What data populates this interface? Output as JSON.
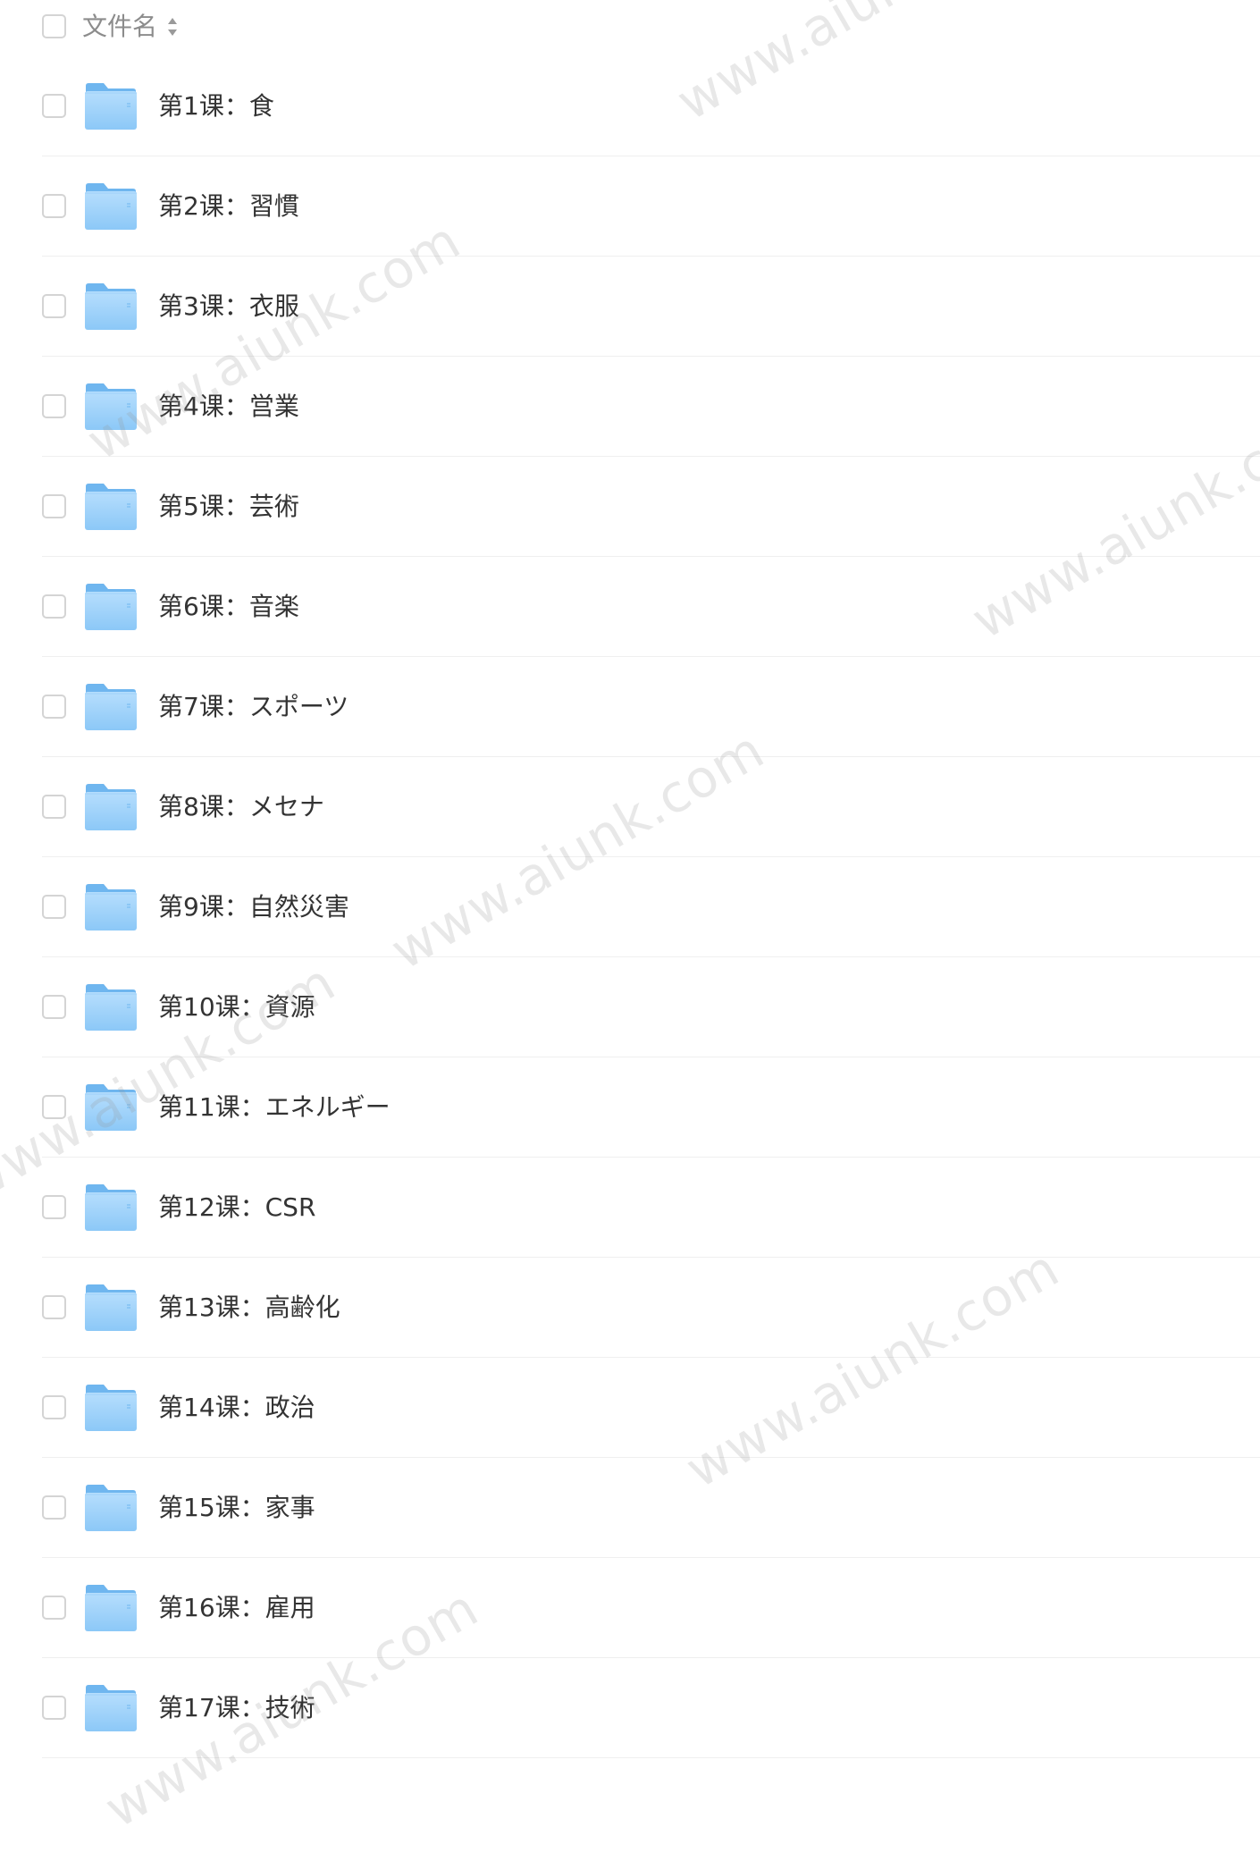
{
  "header": {
    "column_label": "文件名",
    "sort_icon": "sort-updown-icon"
  },
  "files": [
    {
      "name": "第1课：食",
      "icon": "folder-icon"
    },
    {
      "name": "第2课：習慣",
      "icon": "folder-icon"
    },
    {
      "name": "第3课：衣服",
      "icon": "folder-icon"
    },
    {
      "name": "第4课：営業",
      "icon": "folder-icon"
    },
    {
      "name": "第5课：芸術",
      "icon": "folder-icon"
    },
    {
      "name": "第6课：音楽",
      "icon": "folder-icon"
    },
    {
      "name": "第7课：スポーツ",
      "icon": "folder-icon"
    },
    {
      "name": "第8课：メセナ",
      "icon": "folder-icon"
    },
    {
      "name": "第9课：自然災害",
      "icon": "folder-icon"
    },
    {
      "name": "第10课：資源",
      "icon": "folder-icon"
    },
    {
      "name": "第11课：エネルギー",
      "icon": "folder-icon"
    },
    {
      "name": "第12课：CSR",
      "icon": "folder-icon"
    },
    {
      "name": "第13课：高齢化",
      "icon": "folder-icon"
    },
    {
      "name": "第14课：政治",
      "icon": "folder-icon"
    },
    {
      "name": "第15课：家事",
      "icon": "folder-icon"
    },
    {
      "name": "第16课：雇用",
      "icon": "folder-icon"
    },
    {
      "name": "第17课：技術",
      "icon": "folder-icon"
    }
  ],
  "watermark": {
    "text": "www.aiunk.com"
  },
  "colors": {
    "folder_light": "#a9d7fb",
    "folder_dark": "#6fb6ef",
    "divider": "#efefef",
    "text": "#333333",
    "header_text": "#8c8c8c"
  }
}
